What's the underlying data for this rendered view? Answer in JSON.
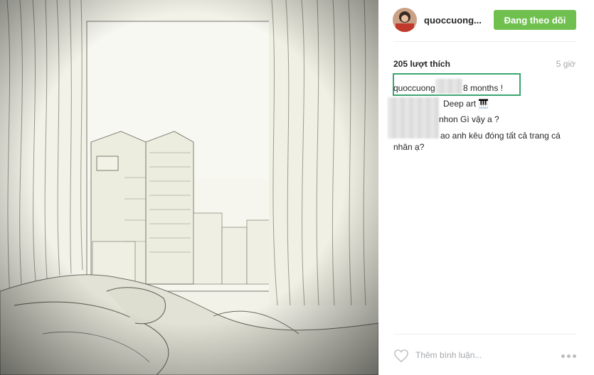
{
  "post": {
    "username": "quoccuong...",
    "follow_label": "Đang theo dõi",
    "likes": "205 lượt thích",
    "time_ago": "5 giờ"
  },
  "comments": [
    {
      "author": "quoccuong",
      "text": "8 months !"
    },
    {
      "author": "",
      "text": "Deep art 🎹"
    },
    {
      "author": "",
      "text": "nhon Gì vậy a ?"
    },
    {
      "author": "",
      "text": "ao anh kêu đóng tất cả trang cá"
    },
    {
      "author": "",
      "text": "nhân ạ?"
    }
  ],
  "footer": {
    "add_comment_placeholder": "Thêm bình luận...",
    "like_icon": "heart-icon",
    "more_icon": "more-options-icon"
  },
  "colors": {
    "follow_button": "#70c050",
    "highlight_border": "#3aa66e",
    "muted_text": "#a5a7aa"
  }
}
